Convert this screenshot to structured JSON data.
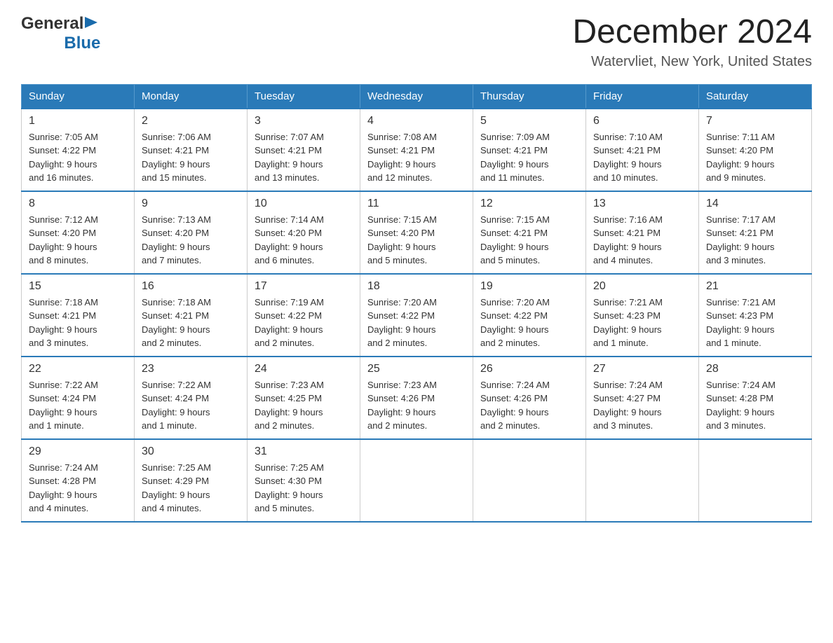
{
  "header": {
    "logo_general": "General",
    "logo_blue": "Blue",
    "title": "December 2024",
    "subtitle": "Watervliet, New York, United States"
  },
  "days_of_week": [
    "Sunday",
    "Monday",
    "Tuesday",
    "Wednesday",
    "Thursday",
    "Friday",
    "Saturday"
  ],
  "weeks": [
    [
      {
        "day": "1",
        "sunrise": "7:05 AM",
        "sunset": "4:22 PM",
        "daylight": "9 hours and 16 minutes."
      },
      {
        "day": "2",
        "sunrise": "7:06 AM",
        "sunset": "4:21 PM",
        "daylight": "9 hours and 15 minutes."
      },
      {
        "day": "3",
        "sunrise": "7:07 AM",
        "sunset": "4:21 PM",
        "daylight": "9 hours and 13 minutes."
      },
      {
        "day": "4",
        "sunrise": "7:08 AM",
        "sunset": "4:21 PM",
        "daylight": "9 hours and 12 minutes."
      },
      {
        "day": "5",
        "sunrise": "7:09 AM",
        "sunset": "4:21 PM",
        "daylight": "9 hours and 11 minutes."
      },
      {
        "day": "6",
        "sunrise": "7:10 AM",
        "sunset": "4:21 PM",
        "daylight": "9 hours and 10 minutes."
      },
      {
        "day": "7",
        "sunrise": "7:11 AM",
        "sunset": "4:20 PM",
        "daylight": "9 hours and 9 minutes."
      }
    ],
    [
      {
        "day": "8",
        "sunrise": "7:12 AM",
        "sunset": "4:20 PM",
        "daylight": "9 hours and 8 minutes."
      },
      {
        "day": "9",
        "sunrise": "7:13 AM",
        "sunset": "4:20 PM",
        "daylight": "9 hours and 7 minutes."
      },
      {
        "day": "10",
        "sunrise": "7:14 AM",
        "sunset": "4:20 PM",
        "daylight": "9 hours and 6 minutes."
      },
      {
        "day": "11",
        "sunrise": "7:15 AM",
        "sunset": "4:20 PM",
        "daylight": "9 hours and 5 minutes."
      },
      {
        "day": "12",
        "sunrise": "7:15 AM",
        "sunset": "4:21 PM",
        "daylight": "9 hours and 5 minutes."
      },
      {
        "day": "13",
        "sunrise": "7:16 AM",
        "sunset": "4:21 PM",
        "daylight": "9 hours and 4 minutes."
      },
      {
        "day": "14",
        "sunrise": "7:17 AM",
        "sunset": "4:21 PM",
        "daylight": "9 hours and 3 minutes."
      }
    ],
    [
      {
        "day": "15",
        "sunrise": "7:18 AM",
        "sunset": "4:21 PM",
        "daylight": "9 hours and 3 minutes."
      },
      {
        "day": "16",
        "sunrise": "7:18 AM",
        "sunset": "4:21 PM",
        "daylight": "9 hours and 2 minutes."
      },
      {
        "day": "17",
        "sunrise": "7:19 AM",
        "sunset": "4:22 PM",
        "daylight": "9 hours and 2 minutes."
      },
      {
        "day": "18",
        "sunrise": "7:20 AM",
        "sunset": "4:22 PM",
        "daylight": "9 hours and 2 minutes."
      },
      {
        "day": "19",
        "sunrise": "7:20 AM",
        "sunset": "4:22 PM",
        "daylight": "9 hours and 2 minutes."
      },
      {
        "day": "20",
        "sunrise": "7:21 AM",
        "sunset": "4:23 PM",
        "daylight": "9 hours and 1 minute."
      },
      {
        "day": "21",
        "sunrise": "7:21 AM",
        "sunset": "4:23 PM",
        "daylight": "9 hours and 1 minute."
      }
    ],
    [
      {
        "day": "22",
        "sunrise": "7:22 AM",
        "sunset": "4:24 PM",
        "daylight": "9 hours and 1 minute."
      },
      {
        "day": "23",
        "sunrise": "7:22 AM",
        "sunset": "4:24 PM",
        "daylight": "9 hours and 1 minute."
      },
      {
        "day": "24",
        "sunrise": "7:23 AM",
        "sunset": "4:25 PM",
        "daylight": "9 hours and 2 minutes."
      },
      {
        "day": "25",
        "sunrise": "7:23 AM",
        "sunset": "4:26 PM",
        "daylight": "9 hours and 2 minutes."
      },
      {
        "day": "26",
        "sunrise": "7:24 AM",
        "sunset": "4:26 PM",
        "daylight": "9 hours and 2 minutes."
      },
      {
        "day": "27",
        "sunrise": "7:24 AM",
        "sunset": "4:27 PM",
        "daylight": "9 hours and 3 minutes."
      },
      {
        "day": "28",
        "sunrise": "7:24 AM",
        "sunset": "4:28 PM",
        "daylight": "9 hours and 3 minutes."
      }
    ],
    [
      {
        "day": "29",
        "sunrise": "7:24 AM",
        "sunset": "4:28 PM",
        "daylight": "9 hours and 4 minutes."
      },
      {
        "day": "30",
        "sunrise": "7:25 AM",
        "sunset": "4:29 PM",
        "daylight": "9 hours and 4 minutes."
      },
      {
        "day": "31",
        "sunrise": "7:25 AM",
        "sunset": "4:30 PM",
        "daylight": "9 hours and 5 minutes."
      },
      null,
      null,
      null,
      null
    ]
  ],
  "labels": {
    "sunrise": "Sunrise:",
    "sunset": "Sunset:",
    "daylight": "Daylight:"
  }
}
